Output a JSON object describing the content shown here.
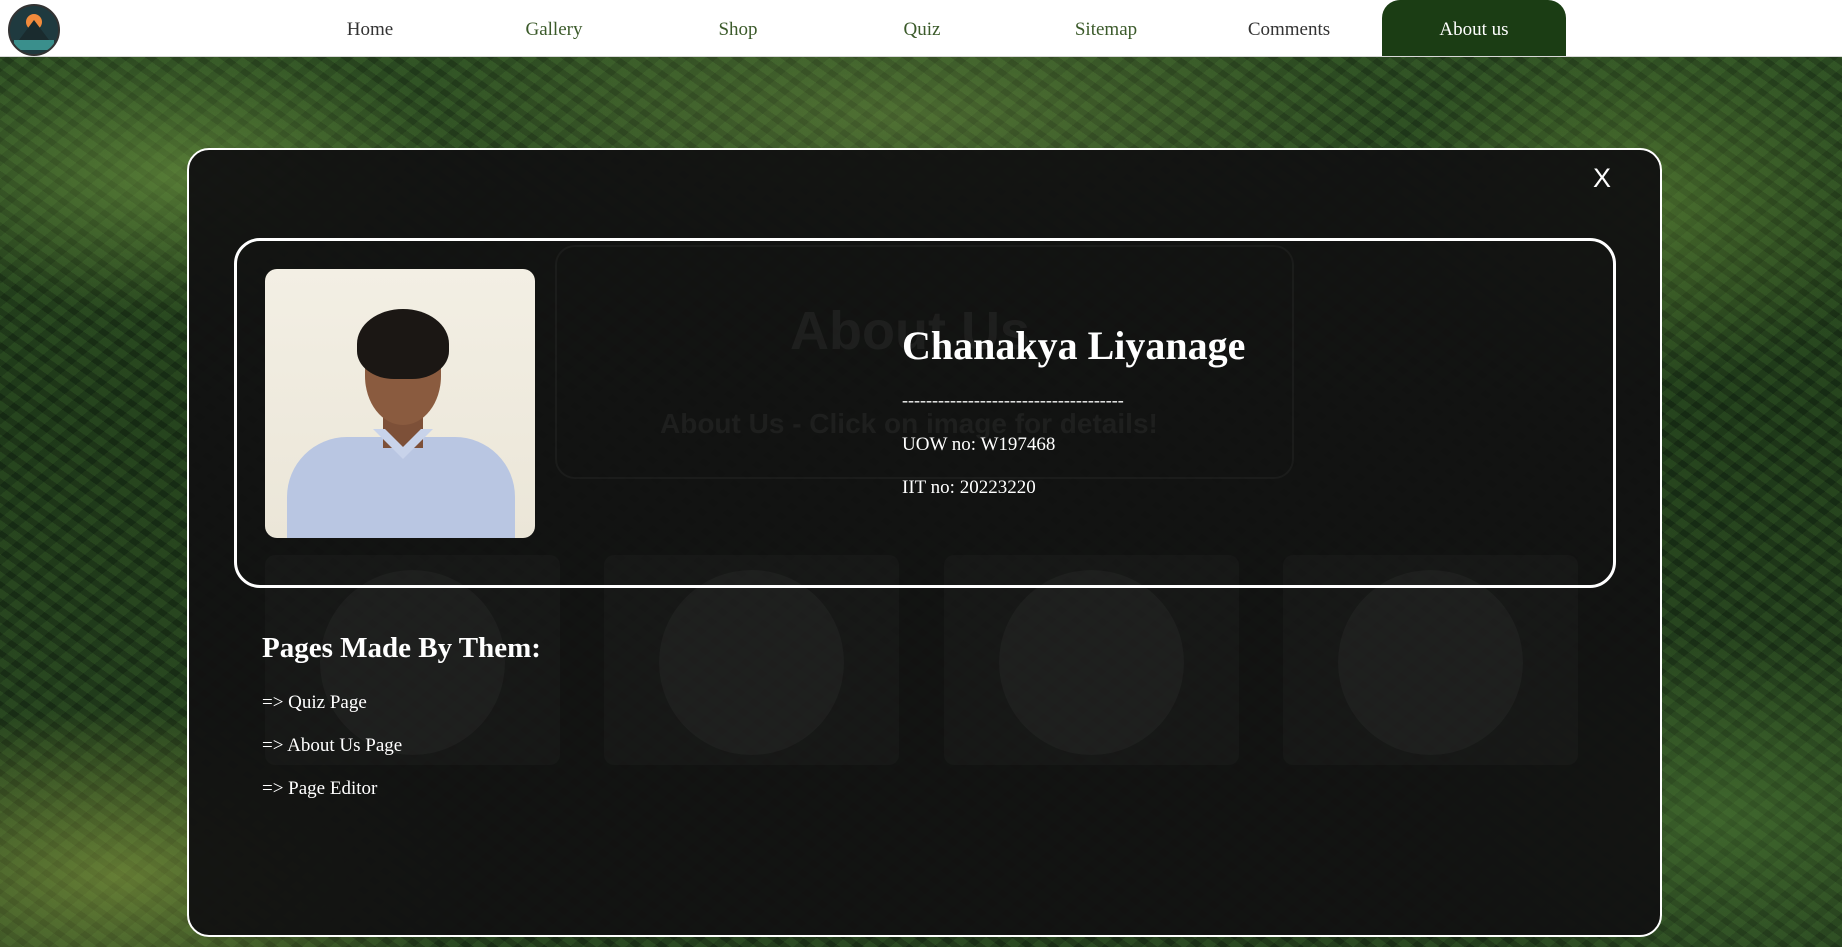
{
  "nav": {
    "items": [
      {
        "label": "Home"
      },
      {
        "label": "Gallery"
      },
      {
        "label": "Shop"
      },
      {
        "label": "Quiz"
      },
      {
        "label": "Sitemap"
      },
      {
        "label": "Comments"
      },
      {
        "label": "About us"
      }
    ],
    "active": "About us",
    "logo": "mountain-sunset-logo"
  },
  "background": {
    "title": "About Us",
    "subtitle": "About Us - Click on image for details!"
  },
  "modal": {
    "close_label": "X",
    "profile": {
      "name": "Chanakya Liyanage",
      "separator": "-------------------------------------",
      "uow": "UOW no: W197468",
      "iit": "IIT no: 20223220"
    },
    "pages_heading": "Pages Made By Them:",
    "pages": [
      "=> Quiz Page",
      "=> About Us Page",
      "=> Page Editor"
    ]
  },
  "colors": {
    "nav_active": "#1b3d14",
    "modal_bg": "#121212",
    "text": "#ffffff"
  }
}
